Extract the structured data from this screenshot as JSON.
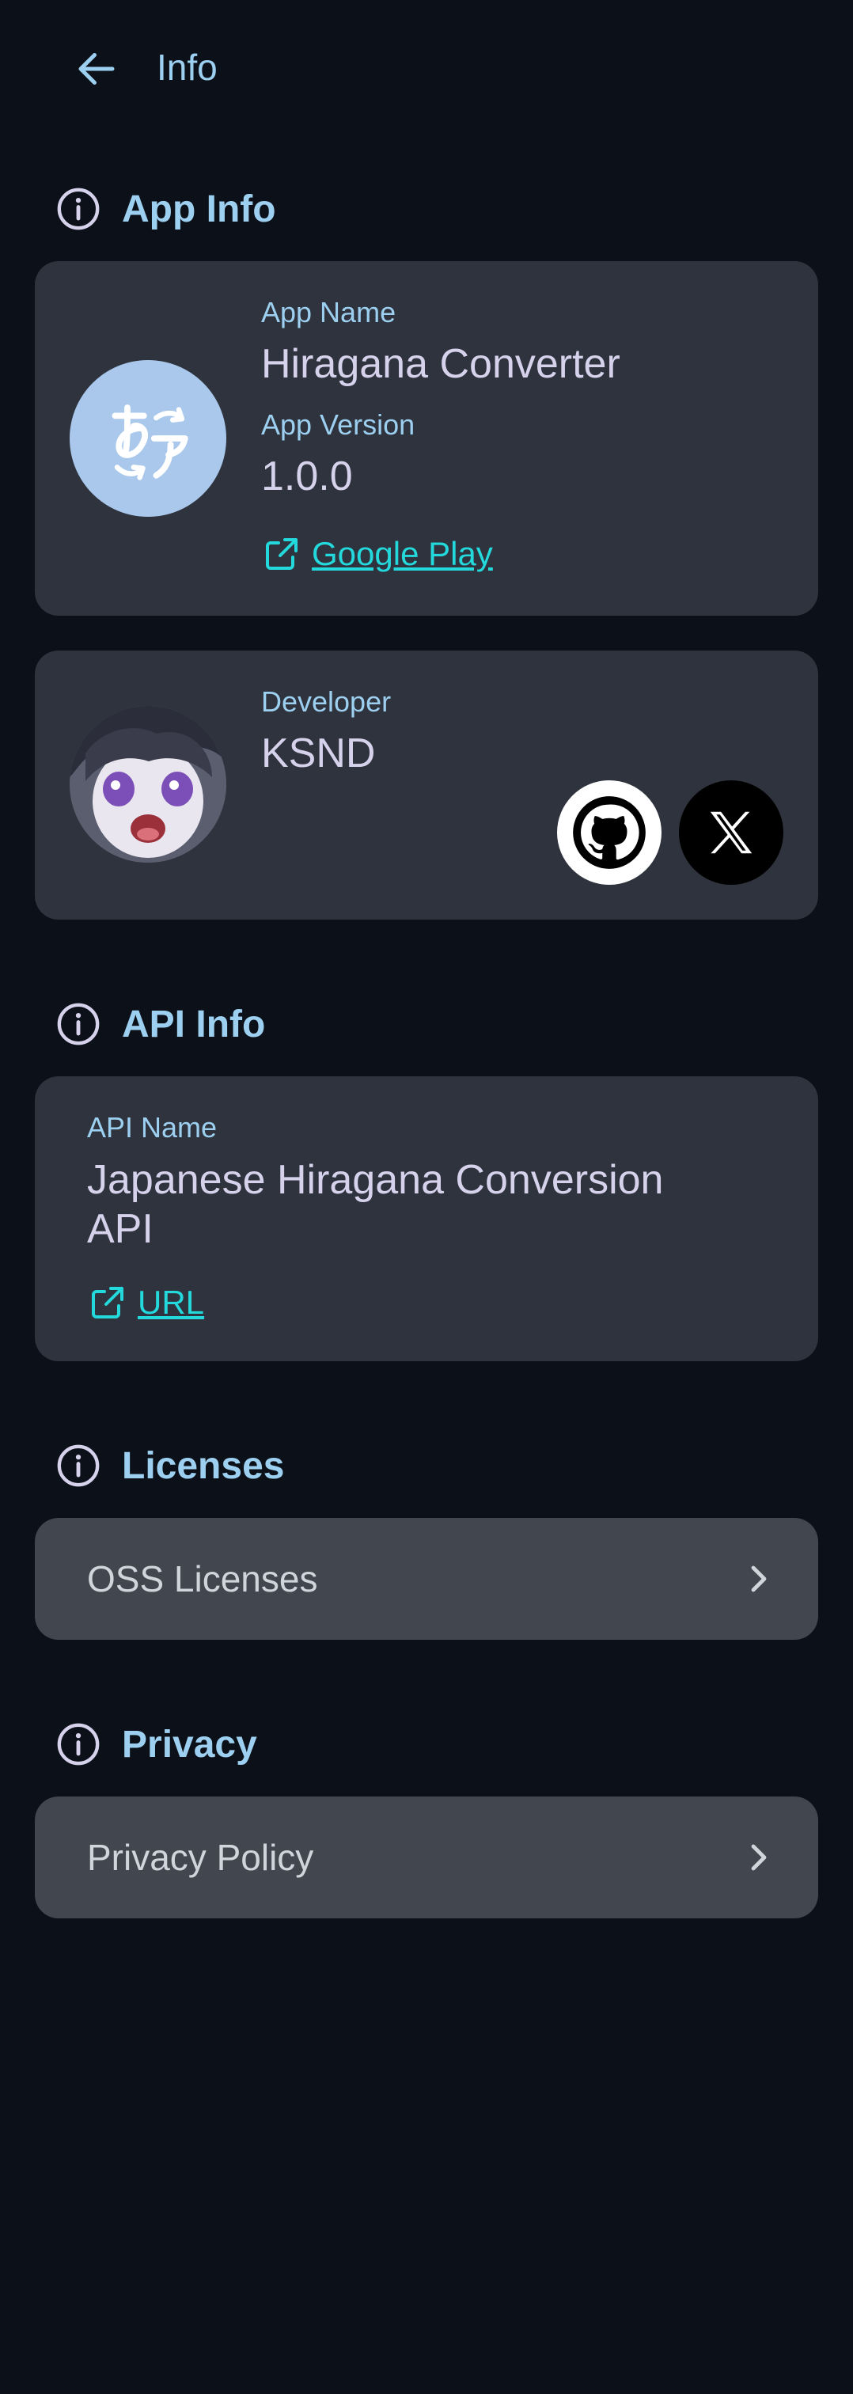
{
  "topbar": {
    "title": "Info"
  },
  "app_info": {
    "section_title": "App Info",
    "app_name_label": "App Name",
    "app_name": "Hiragana Converter",
    "app_version_label": "App Version",
    "app_version": "1.0.0",
    "store_link": "Google Play"
  },
  "developer": {
    "label": "Developer",
    "name": "KSND",
    "socials": [
      "github-icon",
      "x-icon"
    ]
  },
  "api_info": {
    "section_title": "API Info",
    "api_name_label": "API Name",
    "api_name": "Japanese Hiragana Conversion API",
    "url_link": "URL"
  },
  "licenses": {
    "section_title": "Licenses",
    "item": "OSS Licenses"
  },
  "privacy": {
    "section_title": "Privacy",
    "item": "Privacy Policy"
  },
  "colors": {
    "background": "#0c1119",
    "card": "#2e333d",
    "row_card": "#41464f",
    "accent": "#9dd0f0",
    "link": "#24d9dc",
    "value_text": "#d6d2ec"
  }
}
